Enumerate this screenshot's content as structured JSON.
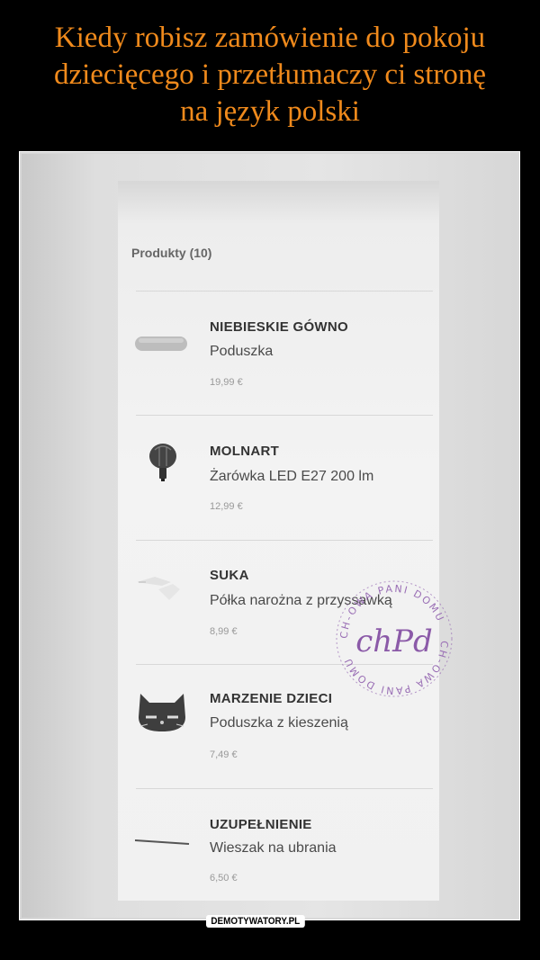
{
  "caption": {
    "line1": "Kiedy robisz zamówienie do pokoju",
    "line2": "dziecięcego i przetłumaczy ci stronę",
    "line3": "na język polski"
  },
  "list": {
    "heading": "Produkty (10)",
    "items": [
      {
        "name": "NIEBIESKIE GÓWNO",
        "desc": "Poduszka",
        "price": "19,99 €",
        "icon": "pillow-icon"
      },
      {
        "name": "MOLNART",
        "desc": "Żarówka LED E27 200 lm",
        "price": "12,99 €",
        "icon": "bulb-icon"
      },
      {
        "name": "SUKA",
        "desc": "Półka narożna z przyssawką",
        "price": "8,99 €",
        "icon": "shelf-icon"
      },
      {
        "name": "MARZENIE DZIECI",
        "desc": "Poduszka z kieszenią",
        "price": "7,49 €",
        "icon": "cat-pillow-icon"
      },
      {
        "name": "UZUPEŁNIENIE",
        "desc": "Wieszak na ubrania",
        "price": "6,50 €",
        "icon": "hanger-icon"
      }
    ]
  },
  "stamp": {
    "ring_top": "CH-OWA PANI DOMU",
    "ring_bottom": "CH-OWA PANI DOMU",
    "center": "chPd"
  },
  "badge": "DEMOTYWATORY.PL",
  "colors": {
    "caption": "#f08a1c",
    "background": "#000000",
    "stamp": "#9a6fb5"
  }
}
